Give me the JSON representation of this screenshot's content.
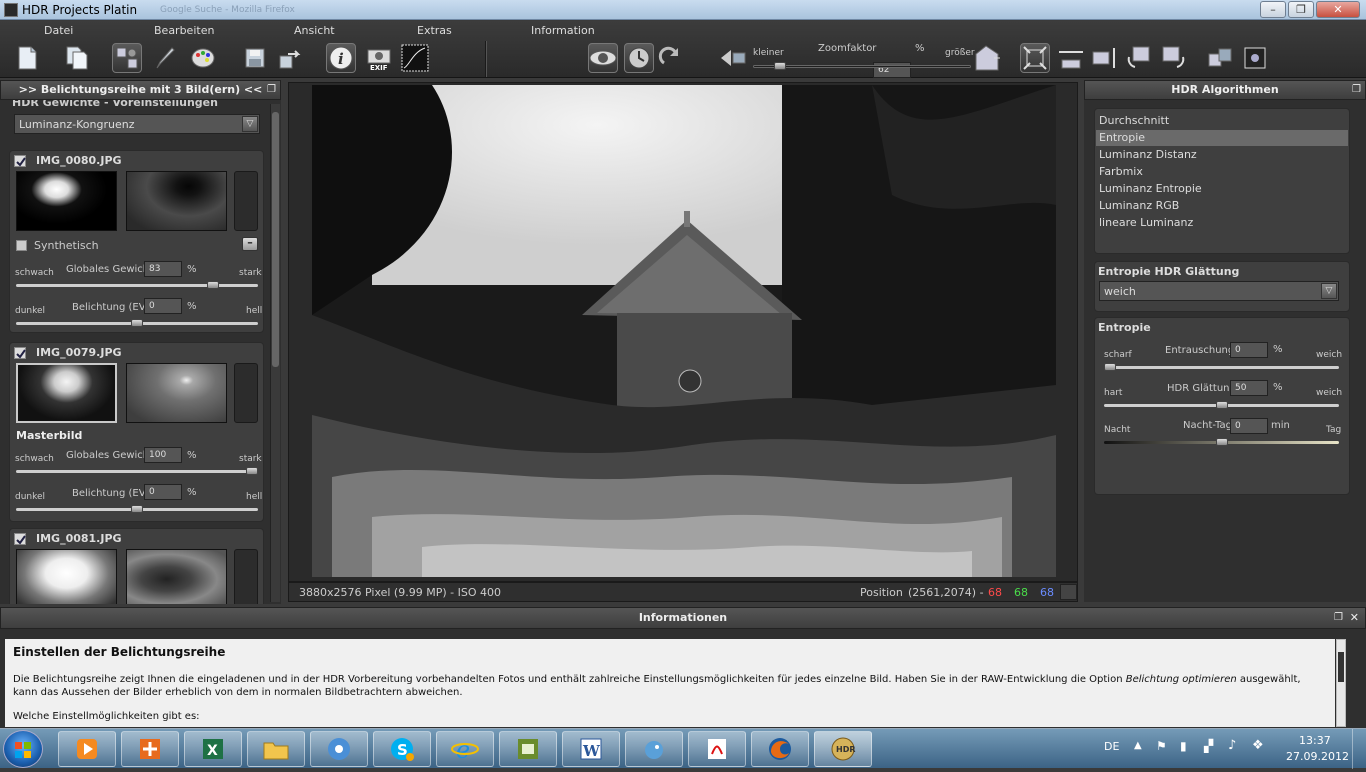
{
  "window": {
    "title": "HDR Projects Platin",
    "faded_tabs": "Google Suche  -  Mozilla Firefox",
    "controls": [
      "–",
      "❐",
      "✕"
    ]
  },
  "menu": [
    "Datei",
    "Bearbeiten",
    "Ansicht",
    "Extras",
    "Information"
  ],
  "toolbar": {
    "zoom_small_label": "kleiner",
    "zoom_label": "Zoomfaktor",
    "zoom_value": "62",
    "zoom_unit": "%",
    "zoom_large_label": "größer",
    "zoom_level": 0.1
  },
  "left_panel": {
    "header": ">> Belichtungsreihe mit 3 Bild(ern) <<",
    "section_partial": "HDR Gewichte - Voreinstellungen",
    "preset": "Luminanz-Kongruenz",
    "images": [
      {
        "name": "IMG_0080.JPG",
        "synthetic_label": "Synthetisch",
        "weight_left": "schwach",
        "weight_label": "Globales Gewicht",
        "weight_value": "83",
        "weight_unit": "%",
        "weight_right": "stark",
        "weight_fraction": 0.83,
        "ev_left": "dunkel",
        "ev_label": "Belichtung (EV)",
        "ev_value": "0",
        "ev_unit": "%",
        "ev_right": "hell",
        "ev_fraction": 0.5
      },
      {
        "name": "IMG_0079.JPG",
        "master_label": "Masterbild",
        "weight_left": "schwach",
        "weight_label": "Globales Gewicht",
        "weight_value": "100",
        "weight_unit": "%",
        "weight_right": "stark",
        "weight_fraction": 1.0,
        "ev_left": "dunkel",
        "ev_label": "Belichtung (EV)",
        "ev_value": "0",
        "ev_unit": "%",
        "ev_right": "hell",
        "ev_fraction": 0.5
      },
      {
        "name": "IMG_0081.JPG"
      }
    ]
  },
  "viewer": {
    "info": "3880x2576 Pixel (9.99 MP)  -  ISO 400",
    "position_label": "Position",
    "position_value": "(2561,2074) -",
    "r": "68",
    "g": "68",
    "b": "68",
    "colors": {
      "r": "#ff4a4a",
      "g": "#4ade4a",
      "b": "#6a8cff"
    }
  },
  "right_panel": {
    "header": "HDR Algorithmen",
    "algorithms": [
      "Durchschnitt",
      "Entropie",
      "Luminanz Distanz",
      "Farbmix",
      "Luminanz Entropie",
      "Luminanz RGB",
      "lineare Luminanz"
    ],
    "selected_index": 1,
    "smoothing_title": "Entropie HDR Glättung",
    "smoothing_value": "weich",
    "entropie": {
      "title": "Entropie",
      "noise": {
        "left": "scharf",
        "label": "Entrauschung",
        "value": "0",
        "unit": "%",
        "right": "weich",
        "fraction": 0.0
      },
      "hdr_smooth": {
        "left": "hart",
        "label": "HDR Glättung",
        "value": "50",
        "unit": "%",
        "right": "weich",
        "fraction": 0.5
      },
      "day_night": {
        "left": "Nacht",
        "label": "Nacht-Tag",
        "value": "0",
        "unit": "min",
        "right": "Tag",
        "fraction": 0.5
      }
    }
  },
  "info": {
    "header": "Informationen",
    "heading": "Einstellen der Belichtungsreihe",
    "text_before": "Die Belichtungsreihe zeigt Ihnen die eingeladenen und in der HDR Vorbereitung vorbehandelten Fotos und enthält zahlreiche Einstellungsmöglichkeiten für jedes einzelne Bild. Haben Sie in der RAW-Entwicklung die Option ",
    "text_italic": "Belichtung optimieren",
    "text_after": " ausgewählt, kann das Aussehen der Bilder erheblich von dem in normalen Bildbetrachtern abweichen.",
    "text_cut": "Welche Einstellmöglichkeiten gibt es:"
  },
  "taskbar": {
    "apps": [
      "media-player",
      "office-install",
      "excel",
      "explorer",
      "itunes",
      "skype",
      "internet-explorer",
      "project",
      "word",
      "paint-bird",
      "acrobat",
      "firefox",
      "hdr-projects"
    ],
    "lang": "DE",
    "time": "13:37",
    "date": "27.09.2012"
  }
}
